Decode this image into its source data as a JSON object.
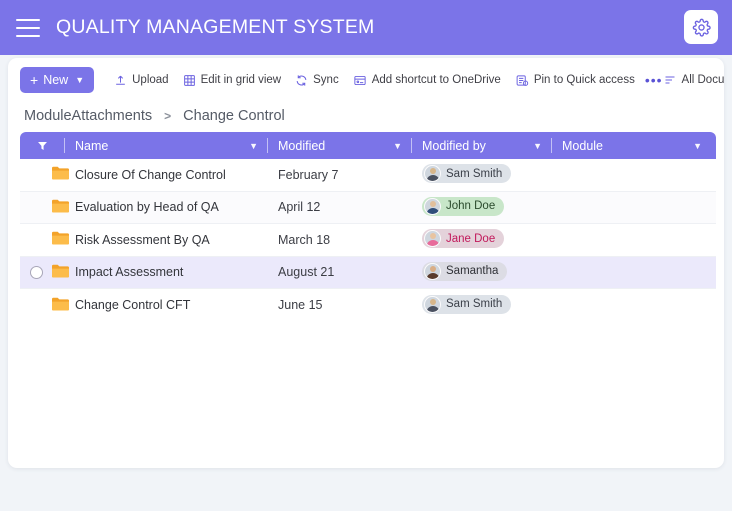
{
  "appbar": {
    "title": "QUALITY MANAGEMENT SYSTEM",
    "menu_icon": "hamburger-menu-icon",
    "settings_icon": "gear-icon",
    "bg_color": "#7b74e8"
  },
  "toolbar": {
    "new_label": "New",
    "new_plus": "+",
    "new_chevron": "⌄",
    "items": [
      {
        "label": "Upload",
        "icon": "upload-icon"
      },
      {
        "label": "Edit in grid view",
        "icon": "grid-icon"
      },
      {
        "label": "Sync",
        "icon": "sync-icon"
      },
      {
        "label": "Add shortcut to OneDrive",
        "icon": "onedrive-shortcut-icon"
      },
      {
        "label": "Pin to Quick access",
        "icon": "pin-icon"
      }
    ],
    "overflow_label": "•••",
    "view_label": "All Documents",
    "view_icon": "list-view-icon",
    "filter_icon": "filter-icon",
    "info_icon": "info-icon",
    "expand_icon": "expand-icon"
  },
  "breadcrumb": {
    "items": [
      "ModuleAttachments",
      "Change Control"
    ],
    "separator": ">"
  },
  "table": {
    "columns": [
      {
        "label": "",
        "icon": "sort-filter-icon"
      },
      {
        "label": "Name",
        "chevron": "⌄"
      },
      {
        "label": "Modified",
        "chevron": "⌄"
      },
      {
        "label": "Modified by",
        "chevron": "⌄"
      },
      {
        "label": "Module",
        "chevron": "⌄"
      }
    ],
    "rows": [
      {
        "name": "Closure Of Change Control",
        "modified": "February 7",
        "modified_by": "Sam Smith",
        "module": "",
        "selected": false,
        "chip_bg": "#dde2e8",
        "chip_text": "#3b4049",
        "avatar_head": "#d7b68a",
        "avatar_body": "#4a5160"
      },
      {
        "name": "Evaluation by Head of QA",
        "modified": "April 12",
        "modified_by": "John Doe",
        "module": "",
        "selected": false,
        "chip_bg": "#c8e6c9",
        "chip_text": "#2a4a2c",
        "avatar_head": "#e0bf9c",
        "avatar_body": "#2f4e7a"
      },
      {
        "name": "Risk Assessment By QA",
        "modified": "March 18",
        "modified_by": "Jane Doe",
        "module": "",
        "selected": false,
        "chip_bg": "#e4d2da",
        "chip_text": "#c2185b",
        "avatar_head": "#e8c4a0",
        "avatar_body": "#e86a9a"
      },
      {
        "name": "Impact Assessment",
        "modified": "August 21",
        "modified_by": "Samantha",
        "module": "",
        "selected": true,
        "chip_bg": "#dcdce4",
        "chip_text": "#2f3136",
        "avatar_head": "#d9ae86",
        "avatar_body": "#5a3b2c"
      },
      {
        "name": "Change Control CFT",
        "modified": "June 15",
        "modified_by": "Sam Smith",
        "module": "",
        "selected": false,
        "chip_bg": "#dde2e8",
        "chip_text": "#3b4049",
        "avatar_head": "#d7b68a",
        "avatar_body": "#4a5160"
      }
    ]
  },
  "colors": {
    "accent": "#7b74e8",
    "page_bg": "#f1f4f8",
    "folder": "#f5a623",
    "selected_row": "#ebe9fb"
  }
}
